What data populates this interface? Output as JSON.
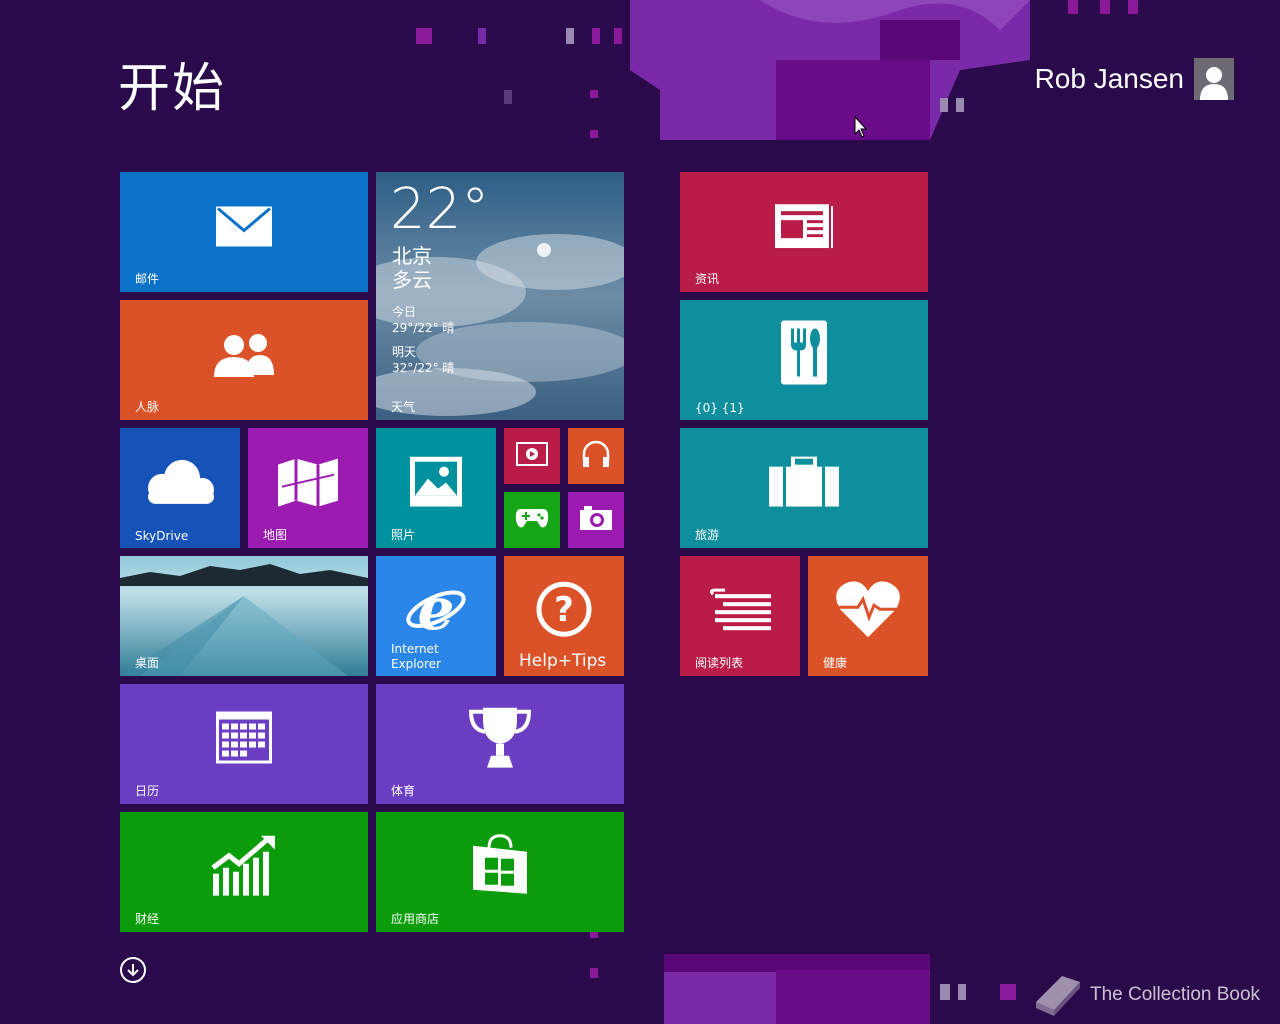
{
  "start_title": "开始",
  "user": {
    "name": "Rob Jansen"
  },
  "tiles": {
    "mail": {
      "label": "邮件",
      "color": "#0b72c8"
    },
    "weather": {
      "label": "天气",
      "temp": "22°",
      "city": "北京",
      "condition": "多云",
      "today_label": "今日",
      "today_forecast": "29°/22° 晴",
      "tomorrow_label": "明天",
      "tomorrow_forecast": "32°/22° 晴"
    },
    "news": {
      "label": "资讯",
      "color": "#b91d47"
    },
    "people": {
      "label": "人脉",
      "color": "#dc5228"
    },
    "food": {
      "label": "{0} {1}",
      "color": "#0f8f9e"
    },
    "skydrive": {
      "label": "SkyDrive",
      "color": "#1553b8"
    },
    "maps": {
      "label": "地图",
      "color": "#9b1bb1"
    },
    "photos": {
      "label": "照片",
      "color": "#00919e"
    },
    "video": {
      "color": "#b91d47"
    },
    "music": {
      "color": "#dc5228"
    },
    "games": {
      "color": "#15a515"
    },
    "camera": {
      "color": "#9b1bb1"
    },
    "travel": {
      "label": "旅游",
      "color": "#0f8f9e"
    },
    "desktop": {
      "label": "桌面"
    },
    "ie": {
      "label_line1": "Internet",
      "label_line2": "Explorer",
      "color": "#2a86e8"
    },
    "help": {
      "label": "Help+Tips",
      "color": "#dc5228"
    },
    "reading": {
      "label": "阅读列表",
      "color": "#b91d47"
    },
    "health": {
      "label": "健康",
      "color": "#dc5228"
    },
    "calendar": {
      "label": "日历",
      "color": "#6a3dc2"
    },
    "sports": {
      "label": "体育",
      "color": "#6a3dc2"
    },
    "finance": {
      "label": "财经",
      "color": "#0a9c0a"
    },
    "store": {
      "label": "应用商店",
      "color": "#0a9c0a"
    }
  },
  "watermark": "The Collection Book"
}
